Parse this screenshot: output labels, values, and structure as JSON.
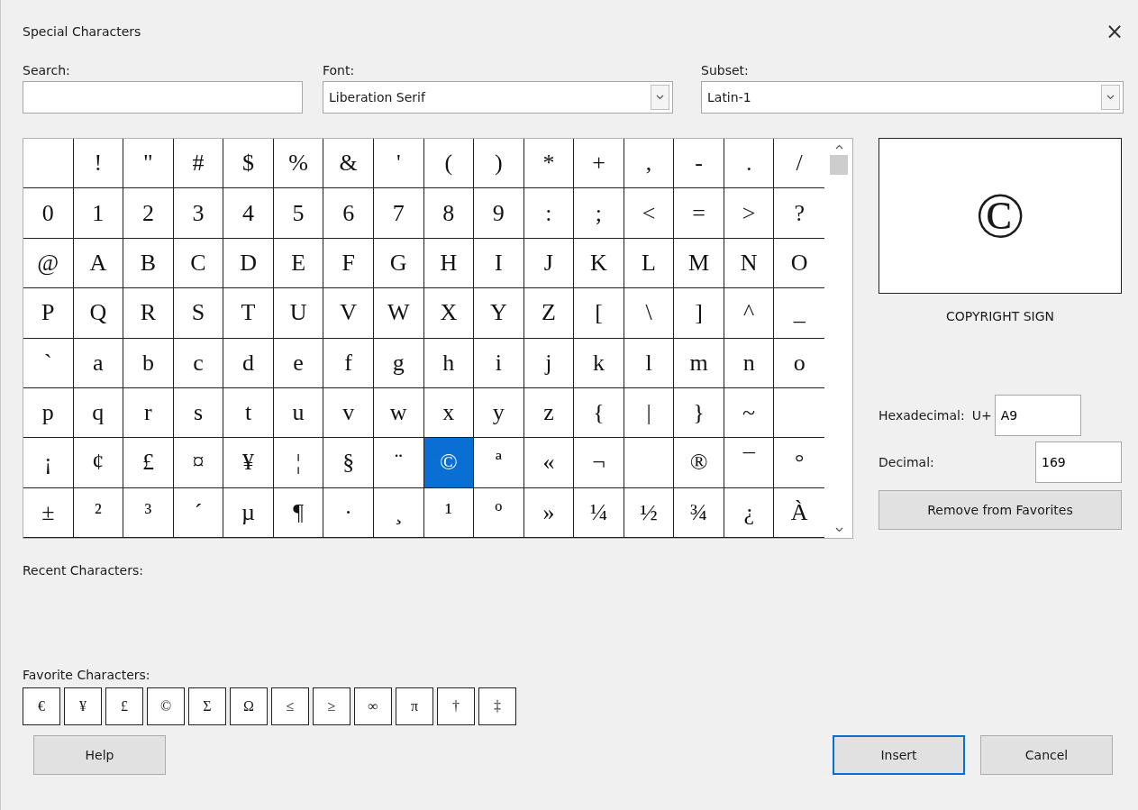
{
  "window": {
    "title": "Special Characters",
    "close": "×"
  },
  "search": {
    "label": "Search:"
  },
  "font": {
    "label": "Font:",
    "value": "Liberation Serif"
  },
  "subset": {
    "label": "Subset:",
    "value": "Latin-1"
  },
  "grid": {
    "rows": [
      [
        {
          "selected": false
        },
        {
          "char": "!",
          "selected": false
        },
        {
          "char": "\"",
          "selected": false
        },
        {
          "char": "#",
          "selected": false
        },
        {
          "char": "$",
          "selected": false
        },
        {
          "char": "%",
          "selected": false
        },
        {
          "char": "&",
          "selected": false
        },
        {
          "char": "'",
          "selected": false
        },
        {
          "char": "(",
          "selected": false
        },
        {
          "char": ")",
          "selected": false
        },
        {
          "char": "*",
          "selected": false
        },
        {
          "char": "+",
          "selected": false
        },
        {
          "char": ",",
          "selected": false
        },
        {
          "char": "-",
          "selected": false
        },
        {
          "char": ".",
          "selected": false
        },
        {
          "char": "/",
          "selected": false
        }
      ],
      [
        {
          "char": "0",
          "selected": false
        },
        {
          "char": "1",
          "selected": false
        },
        {
          "char": "2",
          "selected": false
        },
        {
          "char": "3",
          "selected": false
        },
        {
          "char": "4",
          "selected": false
        },
        {
          "char": "5",
          "selected": false
        },
        {
          "char": "6",
          "selected": false
        },
        {
          "char": "7",
          "selected": false
        },
        {
          "char": "8",
          "selected": false
        },
        {
          "char": "9",
          "selected": false
        },
        {
          "char": ":",
          "selected": false
        },
        {
          "char": ";",
          "selected": false
        },
        {
          "char": "<",
          "selected": false
        },
        {
          "char": "=",
          "selected": false
        },
        {
          "char": ">",
          "selected": false
        },
        {
          "char": "?",
          "selected": false
        }
      ],
      [
        {
          "char": "@",
          "selected": false
        },
        {
          "char": "A",
          "selected": false
        },
        {
          "char": "B",
          "selected": false
        },
        {
          "char": "C",
          "selected": false
        },
        {
          "char": "D",
          "selected": false
        },
        {
          "char": "E",
          "selected": false
        },
        {
          "char": "F",
          "selected": false
        },
        {
          "char": "G",
          "selected": false
        },
        {
          "char": "H",
          "selected": false
        },
        {
          "char": "I",
          "selected": false
        },
        {
          "char": "J",
          "selected": false
        },
        {
          "char": "K",
          "selected": false
        },
        {
          "char": "L",
          "selected": false
        },
        {
          "char": "M",
          "selected": false
        },
        {
          "char": "N",
          "selected": false
        },
        {
          "char": "O",
          "selected": false
        }
      ],
      [
        {
          "char": "P",
          "selected": false
        },
        {
          "char": "Q",
          "selected": false
        },
        {
          "char": "R",
          "selected": false
        },
        {
          "char": "S",
          "selected": false
        },
        {
          "char": "T",
          "selected": false
        },
        {
          "char": "U",
          "selected": false
        },
        {
          "char": "V",
          "selected": false
        },
        {
          "char": "W",
          "selected": false
        },
        {
          "char": "X",
          "selected": false
        },
        {
          "char": "Y",
          "selected": false
        },
        {
          "char": "Z",
          "selected": false
        },
        {
          "char": "[",
          "selected": false
        },
        {
          "char": "\\",
          "selected": false
        },
        {
          "char": "]",
          "selected": false
        },
        {
          "char": "^",
          "selected": false
        },
        {
          "char": "_",
          "selected": false
        }
      ],
      [
        {
          "char": "`",
          "selected": false
        },
        {
          "char": "a",
          "selected": false
        },
        {
          "char": "b",
          "selected": false
        },
        {
          "char": "c",
          "selected": false
        },
        {
          "char": "d",
          "selected": false
        },
        {
          "char": "e",
          "selected": false
        },
        {
          "char": "f",
          "selected": false
        },
        {
          "char": "g",
          "selected": false
        },
        {
          "char": "h",
          "selected": false
        },
        {
          "char": "i",
          "selected": false
        },
        {
          "char": "j",
          "selected": false
        },
        {
          "char": "k",
          "selected": false
        },
        {
          "char": "l",
          "selected": false
        },
        {
          "char": "m",
          "selected": false
        },
        {
          "char": "n",
          "selected": false
        },
        {
          "char": "o",
          "selected": false
        }
      ],
      [
        {
          "char": "p",
          "selected": false
        },
        {
          "char": "q",
          "selected": false
        },
        {
          "char": "r",
          "selected": false
        },
        {
          "char": "s",
          "selected": false
        },
        {
          "char": "t",
          "selected": false
        },
        {
          "char": "u",
          "selected": false
        },
        {
          "char": "v",
          "selected": false
        },
        {
          "char": "w",
          "selected": false
        },
        {
          "char": "x",
          "selected": false
        },
        {
          "char": "y",
          "selected": false
        },
        {
          "char": "z",
          "selected": false
        },
        {
          "char": "{",
          "selected": false
        },
        {
          "char": "|",
          "selected": false
        },
        {
          "char": "}",
          "selected": false
        },
        {
          "char": "~",
          "selected": false
        },
        {
          "selected": false
        }
      ],
      [
        {
          "char": "¡",
          "selected": false
        },
        {
          "char": "¢",
          "selected": false
        },
        {
          "char": "£",
          "selected": false
        },
        {
          "char": "¤",
          "selected": false
        },
        {
          "char": "¥",
          "selected": false
        },
        {
          "char": "¦",
          "selected": false
        },
        {
          "char": "§",
          "selected": false
        },
        {
          "char": "¨",
          "selected": false
        },
        {
          "char": "©",
          "selected": true
        },
        {
          "char": "ª",
          "selected": false
        },
        {
          "char": "«",
          "selected": false
        },
        {
          "char": "¬",
          "selected": false
        },
        {
          "selected": false
        },
        {
          "char": "®",
          "selected": false
        },
        {
          "char": "¯",
          "selected": false
        },
        {
          "char": "°",
          "selected": false
        }
      ],
      [
        {
          "char": "±",
          "selected": false
        },
        {
          "char": "²",
          "selected": false
        },
        {
          "char": "³",
          "selected": false
        },
        {
          "char": "´",
          "selected": false
        },
        {
          "char": "µ",
          "selected": false
        },
        {
          "char": "¶",
          "selected": false
        },
        {
          "char": "·",
          "selected": false
        },
        {
          "char": "¸",
          "selected": false
        },
        {
          "char": "¹",
          "selected": false
        },
        {
          "char": "º",
          "selected": false
        },
        {
          "char": "»",
          "selected": false
        },
        {
          "char": "¼",
          "selected": false
        },
        {
          "char": "½",
          "selected": false
        },
        {
          "char": "¾",
          "selected": false
        },
        {
          "char": "¿",
          "selected": false
        },
        {
          "char": "À",
          "selected": false
        }
      ]
    ]
  },
  "preview": {
    "char": "©",
    "name": "COPYRIGHT SIGN"
  },
  "hexadecimal": {
    "label": "Hexadecimal:",
    "prefix": "U+",
    "value": "A9"
  },
  "decimal": {
    "label": "Decimal:",
    "value": "169"
  },
  "favorite_toggle": "Remove from Favorites",
  "recent": {
    "label": "Recent Characters:"
  },
  "favorites": {
    "label": "Favorite Characters:",
    "chars": [
      "€",
      "¥",
      "£",
      "©",
      "Σ",
      "Ω",
      "≤",
      "≥",
      "∞",
      "π",
      "†",
      "‡"
    ]
  },
  "buttons": [
    {
      "kind": "help",
      "label": "Help",
      "default": false
    },
    {
      "kind": "insert",
      "label": "Insert",
      "default": true
    },
    {
      "kind": "cancel",
      "label": "Cancel",
      "default": false
    }
  ]
}
